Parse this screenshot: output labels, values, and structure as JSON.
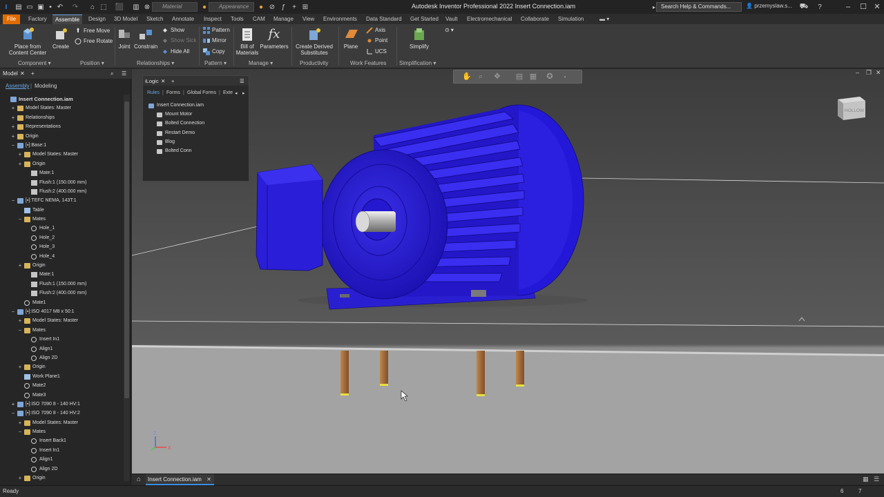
{
  "window": {
    "title": "Autodesk Inventor Professional 2022   Insert Connection.iam",
    "search_placeholder": "Search Help & Commands...",
    "user": "przemyslaw.s...",
    "material_dropdown": "Material",
    "appearance_dropdown": "Appearance"
  },
  "menu": {
    "tabs": [
      "File",
      "Factory",
      "Assemble",
      "Design",
      "3D Model",
      "Sketch",
      "Annotate",
      "Inspect",
      "Tools",
      "CAM",
      "Manage",
      "View",
      "Environments",
      "Data Standard",
      "Get Started",
      "Vault",
      "Electromechanical",
      "Collaborate",
      "Simulation"
    ],
    "active": "Assemble"
  },
  "ribbon": {
    "place": "Place from Content Center",
    "place_l1": "Place from",
    "place_l2": "Content Center",
    "create": "Create",
    "free_move": "Free Move",
    "free_rotate": "Free Rotate",
    "joint": "Joint",
    "constrain": "Constrain",
    "show": "Show",
    "show_sick": "Show Sick",
    "hide_all": "Hide All",
    "pattern": "Pattern",
    "mirror": "Mirror",
    "copy": "Copy",
    "bom_l1": "Bill of",
    "bom_l2": "Materials",
    "parameters": "Parameters",
    "derived_l1": "Create Derived",
    "derived_l2": "Substitutes",
    "plane": "Plane",
    "axis": "Axis",
    "point": "Point",
    "ucs": "UCS",
    "simplify": "Simplify",
    "groups": {
      "component": "Component",
      "position": "Position",
      "relationships": "Relationships",
      "pattern": "Pattern",
      "manage": "Manage",
      "productivity": "Productivity",
      "work_features": "Work Features",
      "simplification": "Simplification"
    }
  },
  "browser": {
    "title": "Model",
    "tab_assembly": "Assembly",
    "tab_modeling": "Modeling",
    "tree": [
      {
        "label": "Insert Connection.iam",
        "level": 0,
        "icon": "asm",
        "exp": ""
      },
      {
        "label": "Model States: Master",
        "level": 1,
        "icon": "fold",
        "exp": "+"
      },
      {
        "label": "Relationships",
        "level": 1,
        "icon": "fold",
        "exp": "+"
      },
      {
        "label": "Representations",
        "level": 1,
        "icon": "fold",
        "exp": "+"
      },
      {
        "label": "Origin",
        "level": 1,
        "icon": "fold",
        "exp": "+"
      },
      {
        "label": "[▪]:Base:1",
        "level": 1,
        "icon": "asm",
        "exp": "−"
      },
      {
        "label": "Model States: Master",
        "level": 2,
        "icon": "fold",
        "exp": "+"
      },
      {
        "label": "Origin",
        "level": 2,
        "icon": "fold",
        "exp": "+"
      },
      {
        "label": "Mate:1",
        "level": 3,
        "icon": "flush",
        "exp": ""
      },
      {
        "label": "Flush:1 (150.000 mm)",
        "level": 3,
        "icon": "flush",
        "exp": ""
      },
      {
        "label": "Flush:2 (400.000 mm)",
        "level": 3,
        "icon": "flush",
        "exp": ""
      },
      {
        "label": "[▪]:TEFC NEMA, 143T:1",
        "level": 1,
        "icon": "asm",
        "exp": "−"
      },
      {
        "label": "Table",
        "level": 2,
        "icon": "part",
        "exp": ""
      },
      {
        "label": "Mates",
        "level": 2,
        "icon": "fold",
        "exp": "−"
      },
      {
        "label": "Hole_1",
        "level": 3,
        "icon": "mate",
        "exp": ""
      },
      {
        "label": "Hole_2",
        "level": 3,
        "icon": "mate",
        "exp": ""
      },
      {
        "label": "Hole_3",
        "level": 3,
        "icon": "mate",
        "exp": ""
      },
      {
        "label": "Hole_4",
        "level": 3,
        "icon": "mate",
        "exp": ""
      },
      {
        "label": "Origin",
        "level": 2,
        "icon": "fold",
        "exp": "+"
      },
      {
        "label": "Mate:1",
        "level": 3,
        "icon": "flush",
        "exp": ""
      },
      {
        "label": "Flush:1 (150.000 mm)",
        "level": 3,
        "icon": "flush",
        "exp": ""
      },
      {
        "label": "Flush:2 (400.000 mm)",
        "level": 3,
        "icon": "flush",
        "exp": ""
      },
      {
        "label": "Mate1",
        "level": 2,
        "icon": "mate",
        "exp": ""
      },
      {
        "label": "[▪]:ISO 4017 M8 x 50:1",
        "level": 1,
        "icon": "asm",
        "exp": "−"
      },
      {
        "label": "Model States: Master",
        "level": 2,
        "icon": "fold",
        "exp": "+"
      },
      {
        "label": "Mates",
        "level": 2,
        "icon": "fold",
        "exp": "−"
      },
      {
        "label": "Insert In1",
        "level": 3,
        "icon": "mate",
        "exp": ""
      },
      {
        "label": "Align1",
        "level": 3,
        "icon": "mate",
        "exp": ""
      },
      {
        "label": "Align 2D",
        "level": 3,
        "icon": "mate",
        "exp": ""
      },
      {
        "label": "Origin",
        "level": 2,
        "icon": "fold",
        "exp": "+"
      },
      {
        "label": "Work Plane1",
        "level": 2,
        "icon": "part",
        "exp": ""
      },
      {
        "label": "Mate2",
        "level": 2,
        "icon": "mate",
        "exp": ""
      },
      {
        "label": "Mate3",
        "level": 2,
        "icon": "mate",
        "exp": ""
      },
      {
        "label": "[▪]:ISO 7090 8 - 140 HV:1",
        "level": 1,
        "icon": "asm",
        "exp": "+"
      },
      {
        "label": "[▪]:ISO 7090 8 - 140 HV:2",
        "level": 1,
        "icon": "asm",
        "exp": "−"
      },
      {
        "label": "Model States: Master",
        "level": 2,
        "icon": "fold",
        "exp": "+"
      },
      {
        "label": "Mates",
        "level": 2,
        "icon": "fold",
        "exp": "−"
      },
      {
        "label": "Insert Back1",
        "level": 3,
        "icon": "mate",
        "exp": ""
      },
      {
        "label": "Insert In1",
        "level": 3,
        "icon": "mate",
        "exp": ""
      },
      {
        "label": "Align1",
        "level": 3,
        "icon": "mate",
        "exp": ""
      },
      {
        "label": "Align 2D",
        "level": 3,
        "icon": "mate",
        "exp": ""
      },
      {
        "label": "Origin",
        "level": 2,
        "icon": "fold",
        "exp": "+"
      }
    ]
  },
  "ilogic": {
    "title": "iLogic",
    "tabs": [
      "Rules",
      "Forms",
      "Global Forms",
      "Exte"
    ],
    "root": "Insert Connection.iam",
    "rules": [
      "Mount Motor",
      "Bolted Connection",
      "Restart Demo",
      "Blog",
      "Bolted Conn"
    ]
  },
  "viewcube": {
    "label": "HOLLOW"
  },
  "axes": {
    "z": "Z",
    "x": "X"
  },
  "doc_tab": "Insert Connection.iam",
  "status": {
    "text": "Ready",
    "num1": "6",
    "num2": "7"
  },
  "colors": {
    "motor": "#2a1fd6",
    "accent": "#e06c00",
    "active_tab": "#3a8ee6",
    "bolt": "#b07a40"
  }
}
